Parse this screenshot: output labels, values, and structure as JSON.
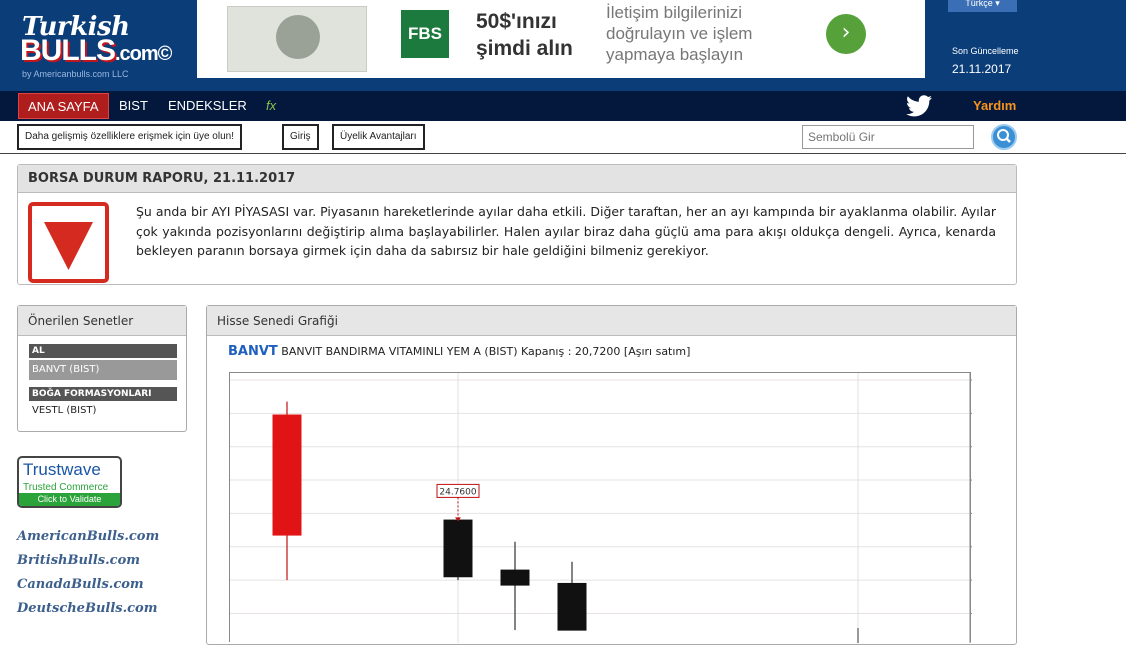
{
  "header": {
    "logo_line1": "Turkish",
    "logo_line2": "BULLS",
    "logo_suffix": ".com©",
    "logo_by": "by Americanbulls.com LLC",
    "language": "Türkçe",
    "last_updated_label": "Son Güncelleme",
    "last_updated_date": "21.11.2017"
  },
  "ad": {
    "brand": "FBS",
    "offer_line1": "50$'ınızı",
    "offer_line2": "şimdi alın",
    "desc_line1": "İletişim bilgilerinizi",
    "desc_line2": "doğrulayın ve işlem",
    "desc_line3": "yapmaya başlayın",
    "go_icon": "chevron-right-icon"
  },
  "nav": {
    "home": "ANA SAYFA",
    "items": [
      "BIST",
      "ENDEKSLER"
    ],
    "fx": "fx",
    "help": "Yardım"
  },
  "subbar": {
    "signup": "Daha gelişmiş özelliklere erişmek için üye olun!",
    "login": "Giriş",
    "benefits": "Üyelik Avantajları",
    "search_placeholder": "Sembolü Gir"
  },
  "report": {
    "title": "BORSA DURUM RAPORU, 21.11.2017",
    "text": "Şu anda bir AYI PİYASASI var. Piyasanın hareketlerinde ayılar daha etkili. Diğer taraftan, her an ayı kampında bir ayaklanma olabilir. Ayılar çok yakında pozisyonlarını değiştirip alıma başlayabilirler. Halen ayılar biraz daha güçlü ama para akışı oldukça dengeli. Ayrıca, kenarda bekleyen paranın borsaya girmek için daha da sabırsız bir hale geldiğini bilmeniz gerekiyor.",
    "status_color": "#d42a20"
  },
  "recommended": {
    "title": "Önerilen Senetler",
    "buy_header": "AL",
    "buy_items": [
      "BANVT (BIST)"
    ],
    "bull_header": "BOĞA FORMASYONLARI",
    "bull_items": [
      "VESTL (BIST)"
    ]
  },
  "trustwave": {
    "name": "Trustwave",
    "tagline": "Trusted Commerce",
    "cta": "Click to Validate"
  },
  "sister_sites": [
    "AmericanBulls.com",
    "BritishBulls.com",
    "CanadaBulls.com",
    "DeutscheBulls.com"
  ],
  "chart_panel": {
    "title": "Hisse Senedi Grafiği",
    "symbol": "BANVT",
    "description": "BANVIT BANDIRMA VITAMINLI YEM A (BIST) Kapanış : 20,7200 [Aşırı satım]"
  },
  "chart_data": {
    "type": "candlestick",
    "ylim": [
      21.5,
      29.2
    ],
    "y_ticks": [
      22,
      23,
      24,
      25,
      26,
      27,
      28,
      29
    ],
    "annotation": {
      "label": "24.7600",
      "value": 24.76,
      "candle_index": 3
    },
    "candles": [
      {
        "slot": 1,
        "open": 24.35,
        "close": 27.95,
        "high": 28.35,
        "low": 23.0,
        "color": "red"
      },
      {
        "slot": 4,
        "open": 24.8,
        "close": 23.1,
        "high": 24.8,
        "low": 23.0,
        "color": "black"
      },
      {
        "slot": 5,
        "open": 23.3,
        "close": 22.85,
        "high": 24.15,
        "low": 21.5,
        "color": "black"
      },
      {
        "slot": 6,
        "open": 22.9,
        "close": 21.5,
        "high": 23.55,
        "low": 21.5,
        "color": "black"
      }
    ],
    "slot_count": 13,
    "grid": true
  }
}
